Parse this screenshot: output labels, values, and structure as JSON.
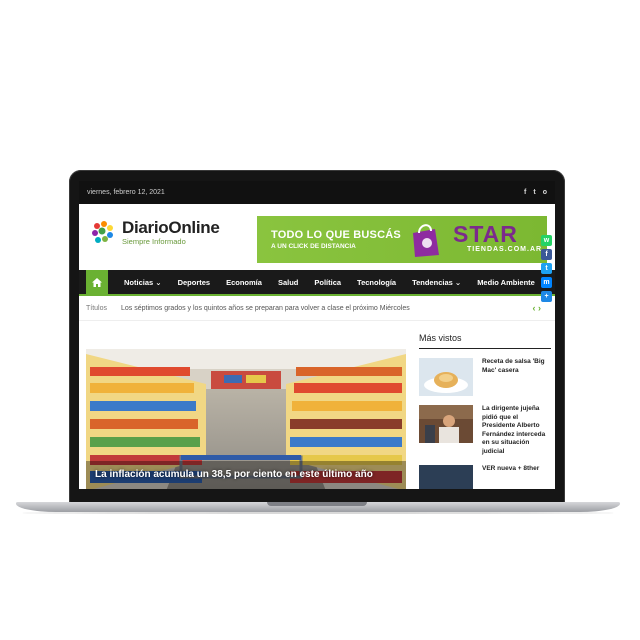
{
  "topbar": {
    "date": "viernes, febrero 12, 2021"
  },
  "social": {
    "facebook": "f",
    "twitter": "t",
    "instagram": "o"
  },
  "logo": {
    "diario": "Diario",
    "online": "Online",
    "tagline": "Siempre Informado"
  },
  "ad": {
    "headline": "TODO LO QUE BUSCÁS",
    "subline": "A UN CLICK DE DISTANCIA",
    "brand": "STAR",
    "brand_sub": "TIENDAS.COM.AR"
  },
  "nav": {
    "items": [
      {
        "label": "Noticias",
        "dropdown": true
      },
      {
        "label": "Deportes"
      },
      {
        "label": "Economía"
      },
      {
        "label": "Salud"
      },
      {
        "label": "Política"
      },
      {
        "label": "Tecnología"
      },
      {
        "label": "Tendencias",
        "dropdown": true
      },
      {
        "label": "Medio Ambiente"
      }
    ]
  },
  "ticker": {
    "label": "Títulos",
    "headline": "Los séptimos grados y los quintos años se preparan para volver a clase el próximo Miércoles"
  },
  "hero": {
    "title": "La inflación acumula un 38,5 por ciento en este último año"
  },
  "sidebar": {
    "title": "Más vistos",
    "items": [
      {
        "text": "Receta de salsa 'Big Mac' casera"
      },
      {
        "text": "La dirigente jujeña pidió que el Presidente Alberto Fernández interceda en su situación judicial"
      },
      {
        "text": "VER nueva + 8ther"
      }
    ]
  },
  "colors": {
    "accent": "#6ab132",
    "dark": "#1a1a1a",
    "brand_purple": "#7b2a8c"
  }
}
